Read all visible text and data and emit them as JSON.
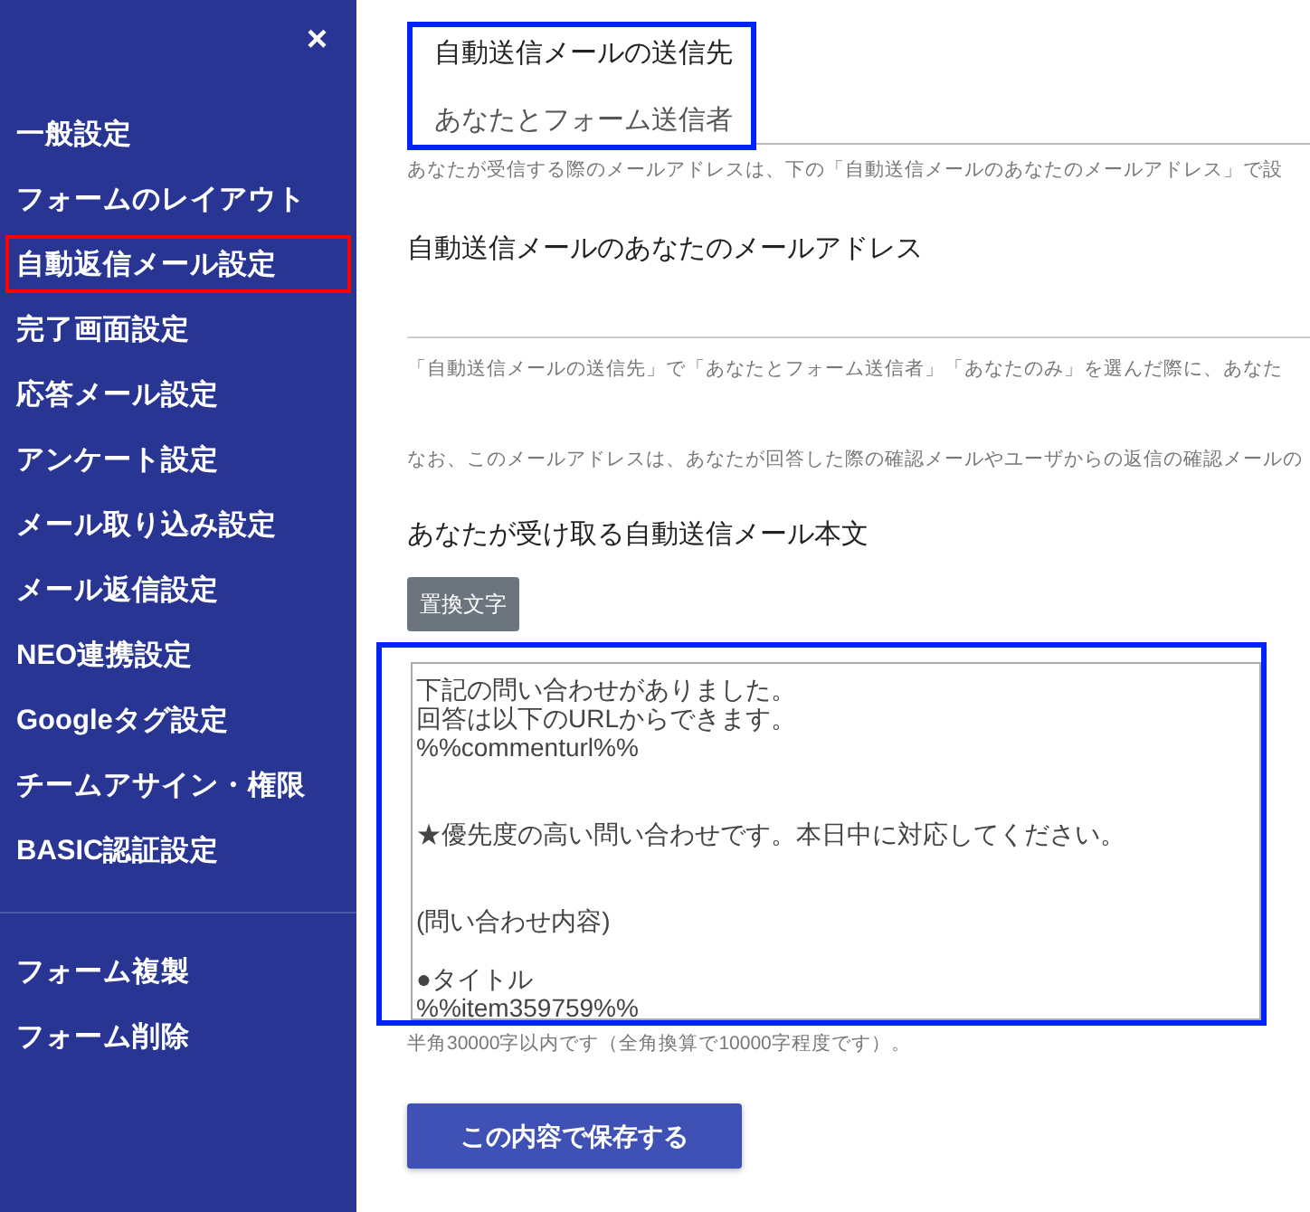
{
  "sidebar": {
    "close_label": "×",
    "items": [
      {
        "label": "一般設定",
        "selected": false
      },
      {
        "label": "フォームのレイアウト",
        "selected": false
      },
      {
        "label": "自動返信メール設定",
        "selected": true
      },
      {
        "label": "完了画面設定",
        "selected": false
      },
      {
        "label": "応答メール設定",
        "selected": false
      },
      {
        "label": "アンケート設定",
        "selected": false
      },
      {
        "label": "メール取り込み設定",
        "selected": false
      },
      {
        "label": "メール返信設定",
        "selected": false
      },
      {
        "label": "NEO連携設定",
        "selected": false
      },
      {
        "label": "Googleタグ設定",
        "selected": false
      },
      {
        "label": "チームアサイン・権限",
        "selected": false
      },
      {
        "label": "BASIC認証設定",
        "selected": false
      }
    ],
    "secondary_items": [
      {
        "label": "フォーム複製"
      },
      {
        "label": "フォーム削除"
      }
    ]
  },
  "form": {
    "recipient": {
      "label": "自動送信メールの送信先",
      "value": "あなたとフォーム送信者",
      "hint": "あなたが受信する際のメールアドレスは、下の「自動送信メールのあなたのメールアドレス」で設"
    },
    "email": {
      "label": "自動送信メールのあなたのメールアドレス",
      "hints": [
        "「自動送信メールの送信先」で「あなたとフォーム送信者」「あなたのみ」を選んだ際に、あなた",
        "なお、このメールアドレスは、あなたが回答した際の確認メールやユーザからの返信の確認メールの"
      ]
    },
    "body": {
      "label": "あなたが受け取る自動送信メール本文",
      "replace_button": "置換文字",
      "paragraphs": [
        [
          "下記の問い合わせがありました。",
          "回答は以下のURLからできます。",
          "%%commenturl%%"
        ],
        [
          "★優先度の高い問い合わせです。本日中に対応してください。"
        ],
        [
          "(問い合わせ内容)"
        ],
        [
          "●タイトル",
          "%%item359759%%"
        ]
      ],
      "hint": "半角30000字以内です（全角換算で10000字程度です）。"
    },
    "save_button": "この内容で保存する"
  }
}
